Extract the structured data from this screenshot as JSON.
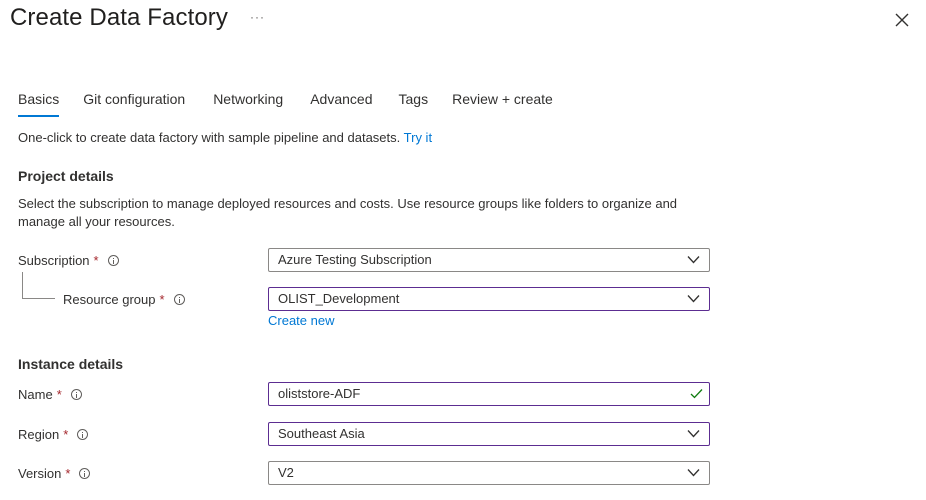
{
  "header": {
    "title": "Create Data Factory",
    "more_label": "···"
  },
  "tabs": [
    {
      "label": "Basics",
      "active": true
    },
    {
      "label": "Git configuration"
    },
    {
      "label": "Networking"
    },
    {
      "label": "Advanced"
    },
    {
      "label": "Tags"
    },
    {
      "label": "Review + create"
    }
  ],
  "intro": {
    "text": "One-click to create data factory with sample pipeline and datasets.",
    "link": "Try it"
  },
  "project": {
    "title": "Project details",
    "description": "Select the subscription to manage deployed resources and costs. Use resource groups like folders to organize and manage all your resources.",
    "subscription": {
      "label": "Subscription",
      "required": "*",
      "value": "Azure Testing Subscription"
    },
    "resource_group": {
      "label": "Resource group",
      "required": "*",
      "value": "OLIST_Development",
      "create_new": "Create new"
    }
  },
  "instance": {
    "title": "Instance details",
    "name": {
      "label": "Name",
      "required": "*",
      "value": "oliststore-ADF"
    },
    "region": {
      "label": "Region",
      "required": "*",
      "value": "Southeast Asia"
    },
    "version": {
      "label": "Version",
      "required": "*",
      "value": "V2"
    }
  },
  "colors": {
    "accent": "#0078d4",
    "required": "#a4262c",
    "focus_border": "#5c2d91",
    "valid_check": "#107c10"
  }
}
